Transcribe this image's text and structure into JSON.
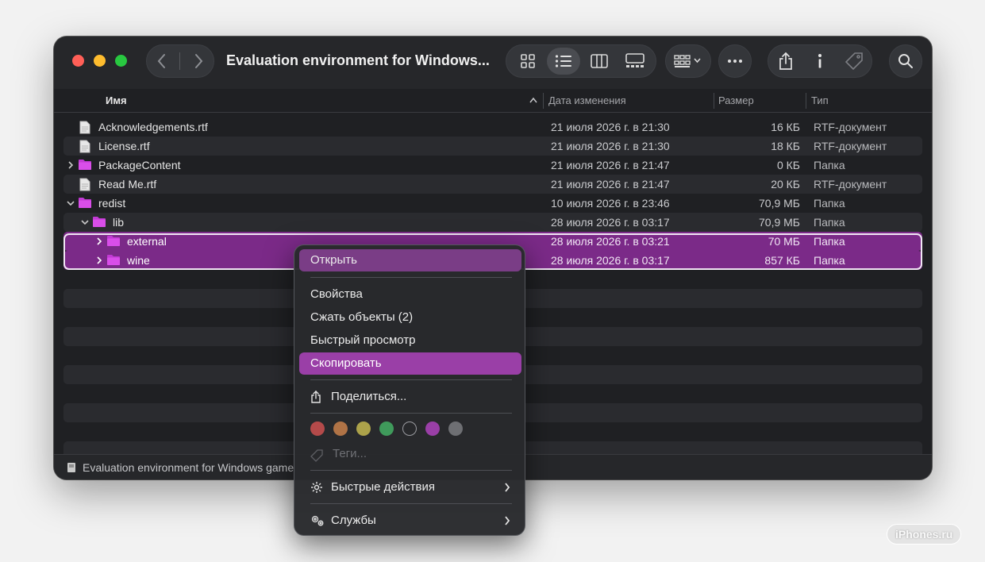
{
  "window": {
    "title": "Evaluation environment for Windows...",
    "path_text": "Evaluation environment for Windows game"
  },
  "toolbar": {
    "icons": [
      "back-icon",
      "forward-icon",
      "icon-view-icon",
      "list-view-icon",
      "column-view-icon",
      "gallery-view-icon",
      "group-icon",
      "more-icon",
      "share-icon",
      "info-icon",
      "tag-icon",
      "search-icon"
    ],
    "active_view": "list"
  },
  "columns": {
    "name": "Имя",
    "date": "Дата изменения",
    "size": "Размер",
    "kind": "Тип"
  },
  "files": [
    {
      "name": "Acknowledgements.rtf",
      "date": "21 июля 2026 г. в 21:30",
      "size": "16 КБ",
      "kind": "RTF-документ",
      "icon": "document-icon"
    },
    {
      "name": "License.rtf",
      "date": "21 июля 2026 г. в 21:30",
      "size": "18 КБ",
      "kind": "RTF-документ",
      "icon": "document-icon"
    },
    {
      "name": "PackageContent",
      "date": "21 июля 2026 г. в 21:47",
      "size": "0 КБ",
      "kind": "Папка",
      "icon": "folder-icon"
    },
    {
      "name": "Read Me.rtf",
      "date": "21 июля 2026 г. в 21:47",
      "size": "20 КБ",
      "kind": "RTF-документ",
      "icon": "document-icon"
    },
    {
      "name": "redist",
      "date": "10 июля 2026 г. в 23:46",
      "size": "70,9 МБ",
      "kind": "Папка",
      "icon": "folder-icon"
    },
    {
      "name": "lib",
      "date": "28 июля 2026 г. в 03:17",
      "size": "70,9 МБ",
      "kind": "Папка",
      "icon": "folder-icon"
    },
    {
      "name": "external",
      "date": "28 июля 2026 г. в 03:21",
      "size": "70 МБ",
      "kind": "Папка",
      "icon": "folder-icon"
    },
    {
      "name": "wine",
      "date": "28 июля 2026 г. в 03:17",
      "size": "857 КБ",
      "kind": "Папка",
      "icon": "folder-icon"
    }
  ],
  "context_menu": {
    "open": "Открыть",
    "properties": "Свойства",
    "compress": "Сжать объекты (2)",
    "quick_look": "Быстрый просмотр",
    "copy": "Скопировать",
    "share": "Поделиться...",
    "tags": "Теги...",
    "quick_actions": "Быстрые действия",
    "services": "Службы",
    "tag_colors": [
      "#b44a4a",
      "#b07346",
      "#aca24a",
      "#3f9a5b",
      "transparent",
      "#9a3fa7",
      "#6e6f73"
    ]
  },
  "colors": {
    "selection": "#7b2a88",
    "highlight": "#9a3fa7",
    "folder": "#c23ad4"
  },
  "watermark": "iPhones.ru"
}
